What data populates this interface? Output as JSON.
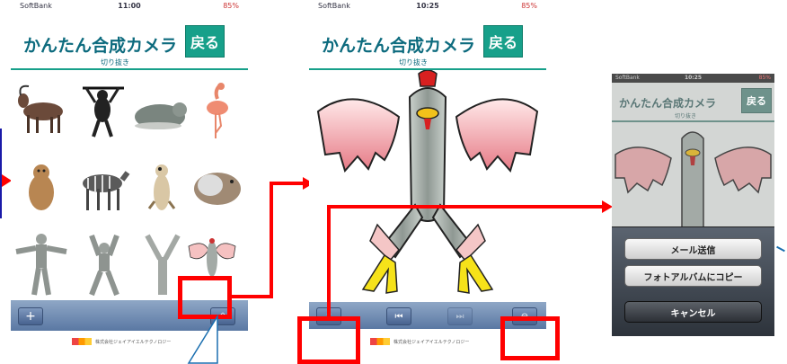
{
  "app": {
    "title": "かんたん合成カメラ",
    "subtitle": "切り抜き",
    "back_label": "戻る"
  },
  "screen1": {
    "carrier": "SoftBank",
    "time": "11:00",
    "battery": "85%"
  },
  "screen2": {
    "carrier": "SoftBank",
    "time": "10:25",
    "battery": "85%"
  },
  "screen3": {
    "carrier": "SoftBank",
    "time": "10:25",
    "battery": "85%"
  },
  "footer": {
    "company": "株式会社ジェイアイエルテクノロジー"
  },
  "toolbar": {
    "add": "+",
    "share": "⇪",
    "rewind": "⏮",
    "play": "▶",
    "next": "⏭",
    "zoom": "⊖"
  },
  "sheet": {
    "mail": "メール送信",
    "copy": "フォトアルバムにコピー",
    "cancel": "キャンセル"
  },
  "colors": {
    "accent": "#17a08a",
    "highlight": "#ff0000",
    "toolbar": "#5a78a3"
  }
}
